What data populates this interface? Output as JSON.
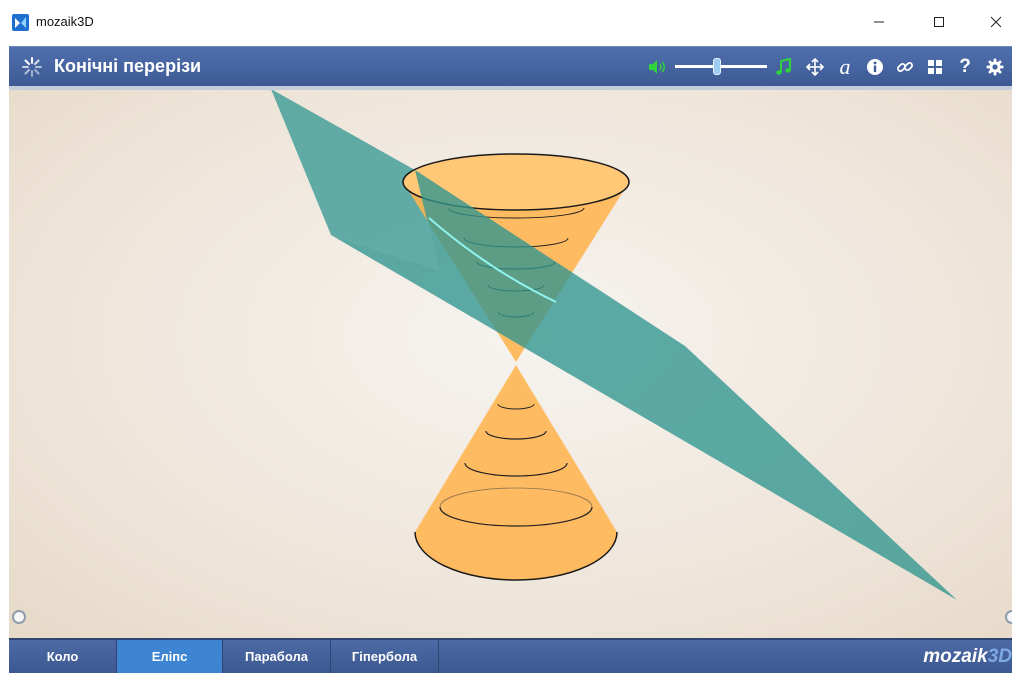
{
  "window": {
    "title": "mozaik3D"
  },
  "toolbar": {
    "title": "Конічні перерізи",
    "volume_level": 0.45
  },
  "tabs": [
    {
      "label": "Коло",
      "active": false
    },
    {
      "label": "Еліпс",
      "active": true
    },
    {
      "label": "Парабола",
      "active": false
    },
    {
      "label": "Гіпербола",
      "active": false
    }
  ],
  "brand": {
    "part1": "mozaik",
    "part2": "3D"
  },
  "colors": {
    "toolbar_blue": "#4563a0",
    "active_tab": "#3d84d3",
    "cone": "#ffb44f",
    "plane": "#2f9590",
    "audio_green": "#2fd33c"
  },
  "icons": [
    "speaker-icon",
    "music-note-icon",
    "move-icon",
    "font-icon",
    "info-icon",
    "link-icon",
    "grid-icon",
    "help-icon",
    "settings-gear-icon"
  ]
}
